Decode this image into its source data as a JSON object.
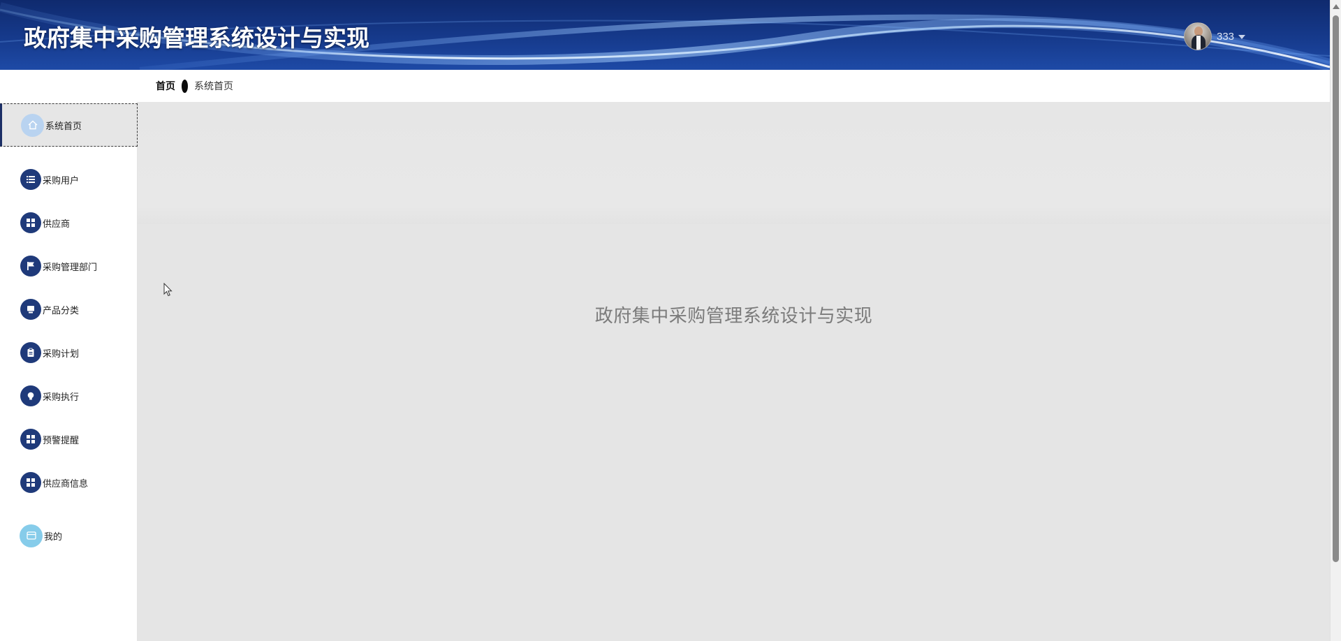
{
  "header": {
    "title": "政府集中采购管理系统设计与实现",
    "username": "333",
    "avatar_icon": "user-avatar",
    "caret_icon": "caret-down-icon"
  },
  "breadcrumb": {
    "home": "首页",
    "separator_icon": "dot-separator-icon",
    "current": "系统首页"
  },
  "sidebar": {
    "items": [
      {
        "label": "系统首页",
        "icon": "home-icon",
        "active": true
      },
      {
        "label": "采购用户",
        "icon": "list-icon"
      },
      {
        "label": "供应商",
        "icon": "grid-icon"
      },
      {
        "label": "采购管理部门",
        "icon": "flag-icon"
      },
      {
        "label": "产品分类",
        "icon": "monitor-icon"
      },
      {
        "label": "采购计划",
        "icon": "clipboard-icon"
      },
      {
        "label": "采购执行",
        "icon": "bulb-icon"
      },
      {
        "label": "预警提醒",
        "icon": "grid-icon"
      },
      {
        "label": "供应商信息",
        "icon": "grid-icon"
      },
      {
        "label": "我的",
        "icon": "window-icon"
      }
    ]
  },
  "main": {
    "title": "政府集中采购管理系统设计与实现"
  },
  "colors": {
    "header_bg": "#163a8c",
    "menu_icon_bg": "#1f3a7a",
    "home_icon_bg": "#b9d3f0",
    "mine_icon_bg": "#86ccea",
    "main_bg": "#e5e5e5",
    "main_title": "#7b7b7b"
  }
}
